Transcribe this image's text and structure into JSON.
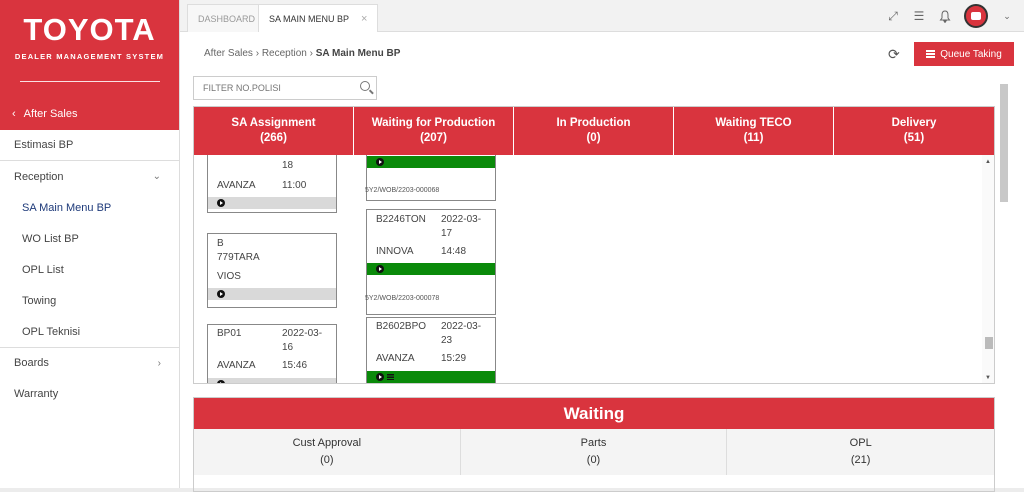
{
  "brand": {
    "logo": "TOYOTA",
    "subtitle": "DEALER MANAGEMENT SYSTEM",
    "back_label": "After Sales"
  },
  "sidebar": {
    "items": [
      {
        "label": "Estimasi BP"
      },
      {
        "label": "Reception"
      },
      {
        "label": "SA Main Menu BP"
      },
      {
        "label": "WO List BP"
      },
      {
        "label": "OPL List"
      },
      {
        "label": "Towing"
      },
      {
        "label": "OPL Teknisi"
      },
      {
        "label": "Boards"
      },
      {
        "label": "Warranty"
      }
    ]
  },
  "tabs": {
    "dashboard": "DASHBOARD",
    "active": "SA MAIN MENU BP",
    "close": "×"
  },
  "breadcrumb": {
    "part1": "After Sales",
    "part2": "Reception",
    "part3": "SA Main Menu BP"
  },
  "queue_button": "Queue Taking",
  "search": {
    "placeholder": "FILTER NO.POLISI"
  },
  "columns": [
    {
      "title": "SA Assignment",
      "count": "(266)"
    },
    {
      "title": "Waiting for Production",
      "count": "(207)"
    },
    {
      "title": "In Production",
      "count": "(0)"
    },
    {
      "title": "Waiting TECO",
      "count": "(11)"
    },
    {
      "title": "Delivery",
      "count": "(51)"
    }
  ],
  "sa_cards": [
    {
      "plate": "",
      "date": "18",
      "model": "AVANZA",
      "time": "11:00"
    },
    {
      "plate": "B",
      "plate2": "779TARA",
      "model": "VIOS"
    },
    {
      "plate": "BP01",
      "date": "2022-03-",
      "date2": "16",
      "model": "AVANZA",
      "time": "15:46"
    }
  ],
  "wp_cards": [
    {
      "wo": "5Y2/WOB/2203-000068"
    },
    {
      "plate": "B2246TON",
      "date": "2022-03-",
      "date2": "17",
      "model": "INNOVA",
      "time": "14:48",
      "wo": "5Y2/WOB/2203-000078"
    },
    {
      "plate": "B2602BPO",
      "date": "2022-03-",
      "date2": "23",
      "model": "AVANZA",
      "time": "15:29"
    }
  ],
  "waiting": {
    "title": "Waiting",
    "cols": [
      {
        "label": "Cust Approval",
        "count": "(0)"
      },
      {
        "label": "Parts",
        "count": "(0)"
      },
      {
        "label": "OPL",
        "count": "(21)"
      }
    ]
  }
}
